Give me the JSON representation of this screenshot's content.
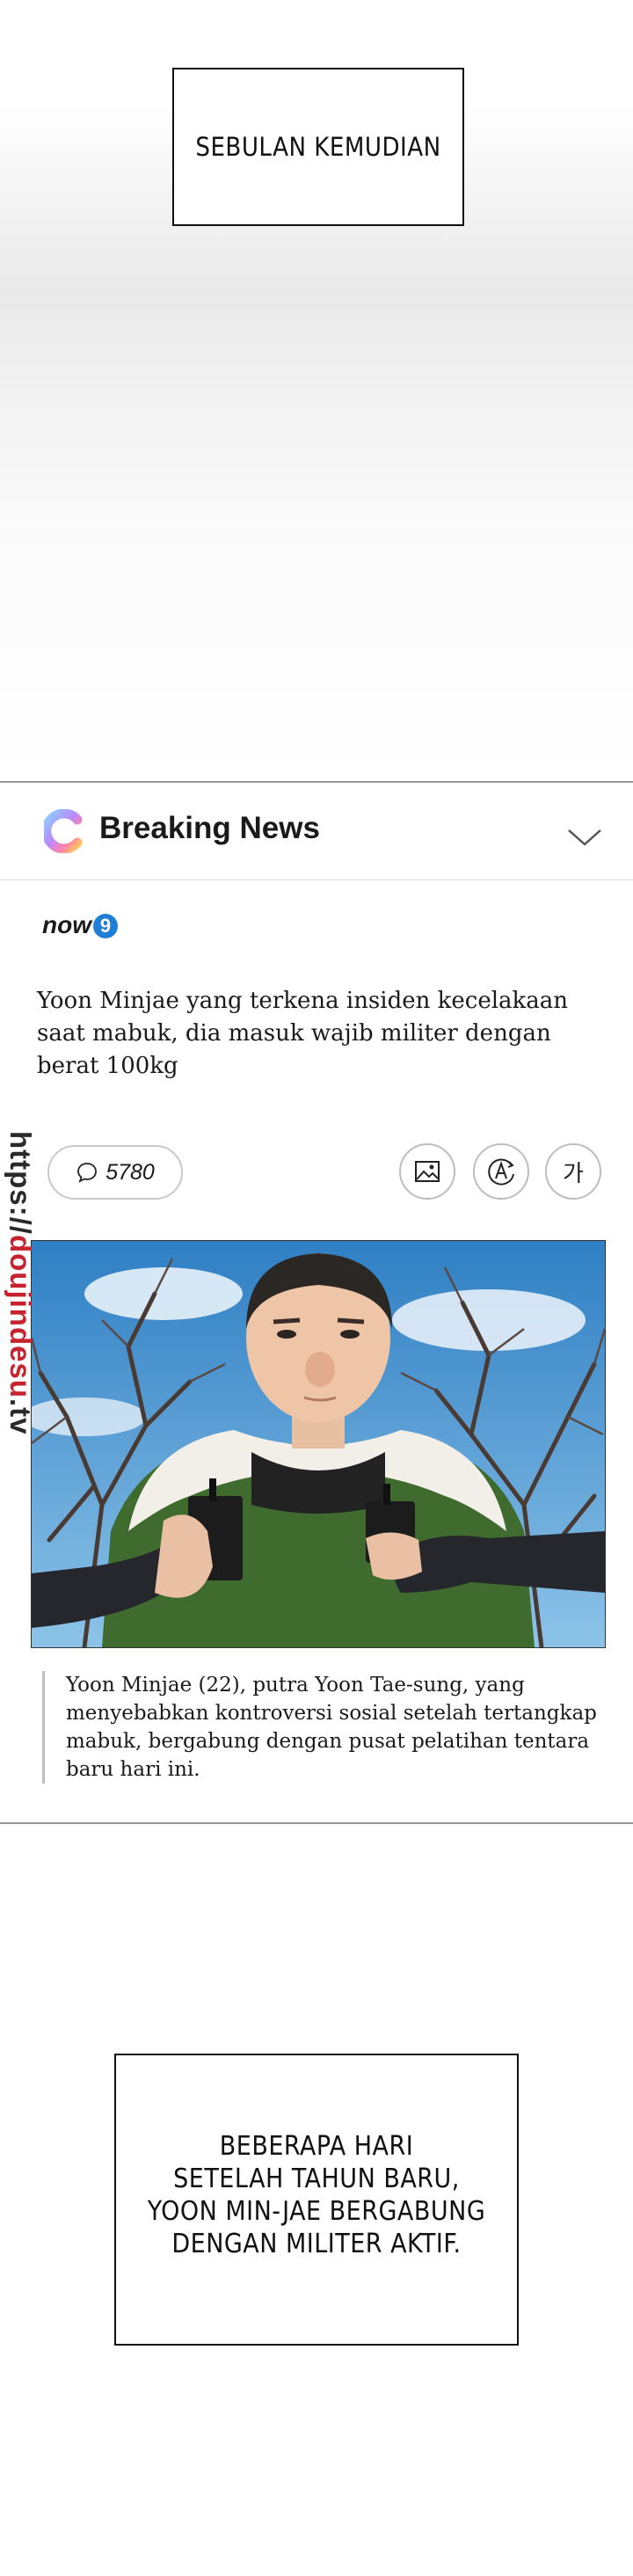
{
  "captions": {
    "top": "SEBULAN KEMUDIAN",
    "bottom": "BEBERAPA HARI\nSETELAH TAHUN BARU,\nYOON MIN-JAE BERGABUNG\nDENGAN MILITER AKTIF."
  },
  "news": {
    "app_title": "Breaking News",
    "app_icon": "c-logo-icon",
    "source": "now",
    "source_badge": "9",
    "headline": "Yoon Minjae yang terkena insiden kecelakaan saat mabuk, dia masuk wajib militer dengan berat 100kg",
    "comment_count": "5780",
    "lang_button": "가",
    "caption": "Yoon Minjae (22), putra Yoon Tae-sung, yang menyebabkan kontroversi sosial setelah tertangkap mabuk, bergabung dengan pusat pelatihan tentara baru hari ini."
  },
  "watermark": {
    "prefix": "https://",
    "accent": "doujindesu",
    "suffix": ".tv"
  },
  "colors": {
    "divider": "#9a9a9a",
    "now_badge": "#1f7fd6",
    "watermark_accent": "#c7232f"
  }
}
